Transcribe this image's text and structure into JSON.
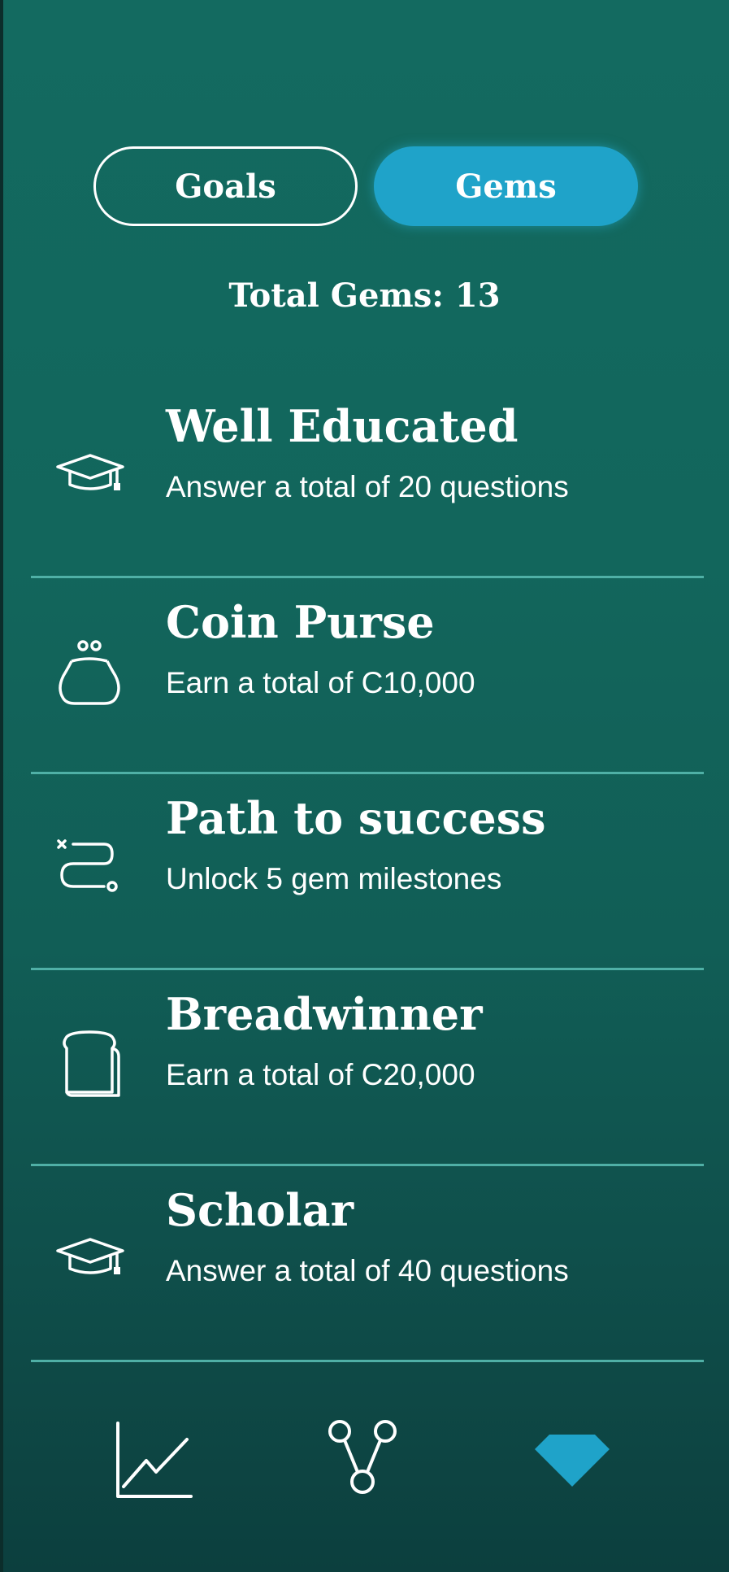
{
  "tabs": {
    "goals_label": "Goals",
    "gems_label": "Gems"
  },
  "summary": {
    "total_gems": "Total Gems: 13"
  },
  "gems": [
    {
      "title": "Well Educated",
      "description": "Answer a total of 20 questions",
      "icon": "graduation-cap-icon"
    },
    {
      "title": "Coin Purse",
      "description": "Earn a total of C10,000",
      "icon": "coin-purse-icon"
    },
    {
      "title": "Path to success",
      "description": "Unlock 5 gem milestones",
      "icon": "path-route-icon"
    },
    {
      "title": "Breadwinner",
      "description": "Earn a total of C20,000",
      "icon": "bread-loaf-icon"
    },
    {
      "title": "Scholar",
      "description": "Answer a total of 40 questions",
      "icon": "graduation-cap-icon"
    }
  ],
  "nav": {
    "items": [
      {
        "icon": "line-chart-icon",
        "active": false
      },
      {
        "icon": "network-nodes-icon",
        "active": false
      },
      {
        "icon": "diamond-gem-icon",
        "active": true
      }
    ]
  },
  "colors": {
    "background_top": "#136a60",
    "background_bottom": "#0c3f3e",
    "accent": "#1fa3c9",
    "divider": "#4fb0a6",
    "text": "#ffffff"
  }
}
